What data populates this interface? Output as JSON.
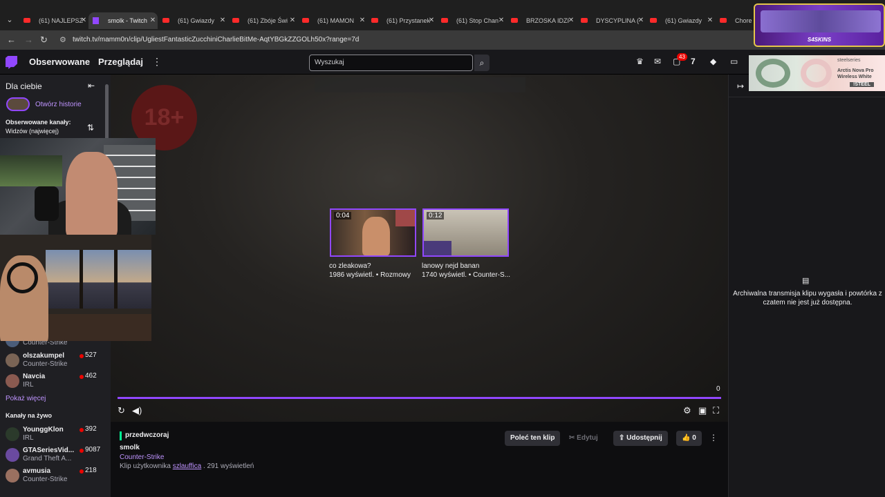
{
  "browser": {
    "tabs": [
      {
        "label": "(61) NAJLEPSZ",
        "kind": "youtube"
      },
      {
        "label": "smolk - Twitch",
        "kind": "twitch",
        "active": true
      },
      {
        "label": "(61) Gwiazdy",
        "kind": "youtube"
      },
      {
        "label": "(61) Zbóje Świ",
        "kind": "youtube"
      },
      {
        "label": "(61) MAMON",
        "kind": "youtube"
      },
      {
        "label": "(61) Przystanek",
        "kind": "youtube"
      },
      {
        "label": "(61) Stop Chan",
        "kind": "youtube"
      },
      {
        "label": "BRZOSKA IDZI",
        "kind": "youtube"
      },
      {
        "label": "DYSCYPLINA (",
        "kind": "youtube"
      },
      {
        "label": "(61) Gwiazdy",
        "kind": "youtube"
      },
      {
        "label": "Chore U",
        "kind": "youtube"
      }
    ],
    "url": "twitch.tv/mamm0n/clip/UgliestFantasticZucchiniCharlieBitMe-AqtYBGkZZGOLh50x?range=7d"
  },
  "topnav": {
    "following": "Obserwowane",
    "browse": "Przeglądaj",
    "search_placeholder": "Wyszukaj",
    "notifications_count": "43"
  },
  "sidebar": {
    "for_you": "Dla ciebie",
    "open_history": "Otwórz historie",
    "followed_title": "Obserwowane kanały:",
    "followed_sort": "Widzów (najwięcej)",
    "followed_channels": [
      {
        "name": "",
        "game": "Counter-Strike",
        "viewers": ""
      },
      {
        "name": "olszakumpel",
        "game": "Counter-Strike",
        "viewers": "527"
      },
      {
        "name": "Navcia",
        "game": "IRL",
        "viewers": "462"
      }
    ],
    "show_more": "Pokaż więcej",
    "live_title": "Kanały na żywo",
    "live_channels": [
      {
        "name": "YounggKlon",
        "game": "IRL",
        "viewers": "392"
      },
      {
        "name": "GTASeriesVid...",
        "game": "Grand Theft A...",
        "viewers": "9087"
      },
      {
        "name": "avmusia",
        "game": "Counter-Strike",
        "viewers": "218"
      }
    ]
  },
  "player": {
    "badge": "18+",
    "recommendations": [
      {
        "duration": "0:04",
        "title": "co zleakowa?",
        "meta": "1986 wyświetl. • Rozmowy"
      },
      {
        "duration": "0:12",
        "title": "lanowy nejd banan",
        "meta": "1740 wyświetl. • Counter-S..."
      }
    ],
    "time": "0",
    "progress": 1.0
  },
  "clip": {
    "date": "przedwczoraj",
    "title": "smolk",
    "game": "Counter-Strike",
    "by_prefix": "Klip użytkownika",
    "by_user": "szlauffica",
    "views": ". 291 wyświetleń",
    "recommend": "Poleć ten klip",
    "edit": "Edytuj",
    "share": "Udostępnij",
    "likes": "0"
  },
  "chat": {
    "message": "Archiwalna transmisja klipu wygasła i powtórka z czatem nie jest już dostępna."
  },
  "ads": {
    "skins_brand": "S4SKINS",
    "steel_brand": "steelseries",
    "steel_product": "Arctis Nova Pro Wireless White",
    "steel_code": "!STEEL"
  },
  "colors": {
    "accent": "#9147ff",
    "live": "#eb0400",
    "link": "#bf94ff"
  }
}
